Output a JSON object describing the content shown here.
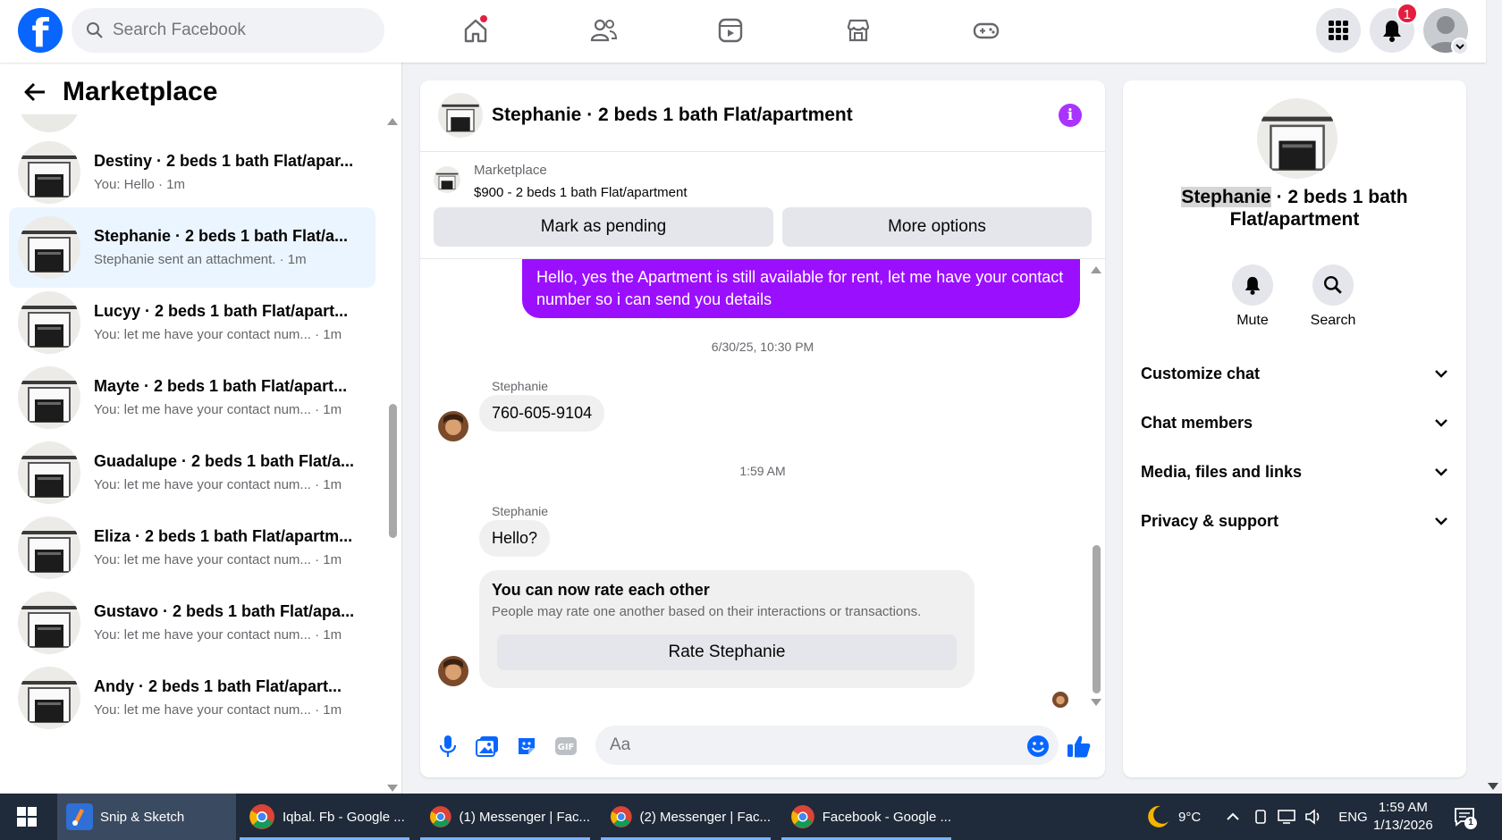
{
  "topbar": {
    "logo": "f",
    "search_placeholder": "Search Facebook",
    "notifications_count": "1"
  },
  "sidebar": {
    "title": "Marketplace",
    "conversations": [
      {
        "name": "Destiny · 2 beds 1 bath Flat/apar...",
        "preview": "You: Hello · 1m"
      },
      {
        "name": "Stephanie · 2 beds 1 bath Flat/a...",
        "preview": "Stephanie sent an attachment. · 1m"
      },
      {
        "name": "Lucyy · 2 beds 1 bath Flat/apart...",
        "preview": "You: let me have your contact num... · 1m"
      },
      {
        "name": "Mayte · 2 beds 1 bath Flat/apart...",
        "preview": "You: let me have your contact num... · 1m"
      },
      {
        "name": "Guadalupe · 2 beds 1 bath Flat/a...",
        "preview": "You: let me have your contact num... · 1m"
      },
      {
        "name": "Eliza · 2 beds 1 bath Flat/apartm...",
        "preview": "You: let me have your contact num... · 1m"
      },
      {
        "name": "Gustavo · 2 beds 1 bath Flat/apa...",
        "preview": "You: let me have your contact num... · 1m"
      },
      {
        "name": "Andy · 2 beds 1 bath Flat/apart...",
        "preview": "You: let me have your contact num... · 1m"
      }
    ]
  },
  "chat": {
    "title": "Stephanie · 2 beds 1 bath Flat/apartment",
    "listing_label": "Marketplace",
    "listing_desc": "$900 - 2 beds 1 bath Flat/apartment",
    "mark_pending": "Mark as pending",
    "more_options": "More options",
    "sent_message": "Hello, yes the Apartment is still available for rent, let me have your contact number so i can send you details",
    "timestamp1": "6/30/25, 10:30 PM",
    "sender1": "Stephanie",
    "message1": "760-605-9104",
    "timestamp2": "1:59 AM",
    "sender2": "Stephanie",
    "message2": "Hello?",
    "rate_title": "You can now rate each other",
    "rate_sub": "People may rate one another based on their interactions or transactions.",
    "rate_button": "Rate Stephanie",
    "input_placeholder": "Aa"
  },
  "info": {
    "name_highlight": "Stephanie",
    "name_rest": " · 2 beds 1 bath Flat/apartment",
    "mute": "Mute",
    "search": "Search",
    "sections": [
      "Customize chat",
      "Chat members",
      "Media, files and links",
      "Privacy & support"
    ]
  },
  "taskbar": {
    "apps": [
      "Snip & Sketch",
      "Iqbal. Fb - Google ...",
      "(1) Messenger | Fac...",
      "(2) Messenger | Fac...",
      "Facebook - Google ..."
    ],
    "weather": "9°C",
    "language": "ENG",
    "time": "1:59 AM",
    "date": "1/13/2026",
    "notif_count": "1"
  },
  "colors": {
    "brand": "#0866ff",
    "sent_bubble": "#9b0fff",
    "info_icon": "#a933ff",
    "active_conv": "#ebf5ff",
    "badge": "#e41e3f"
  }
}
